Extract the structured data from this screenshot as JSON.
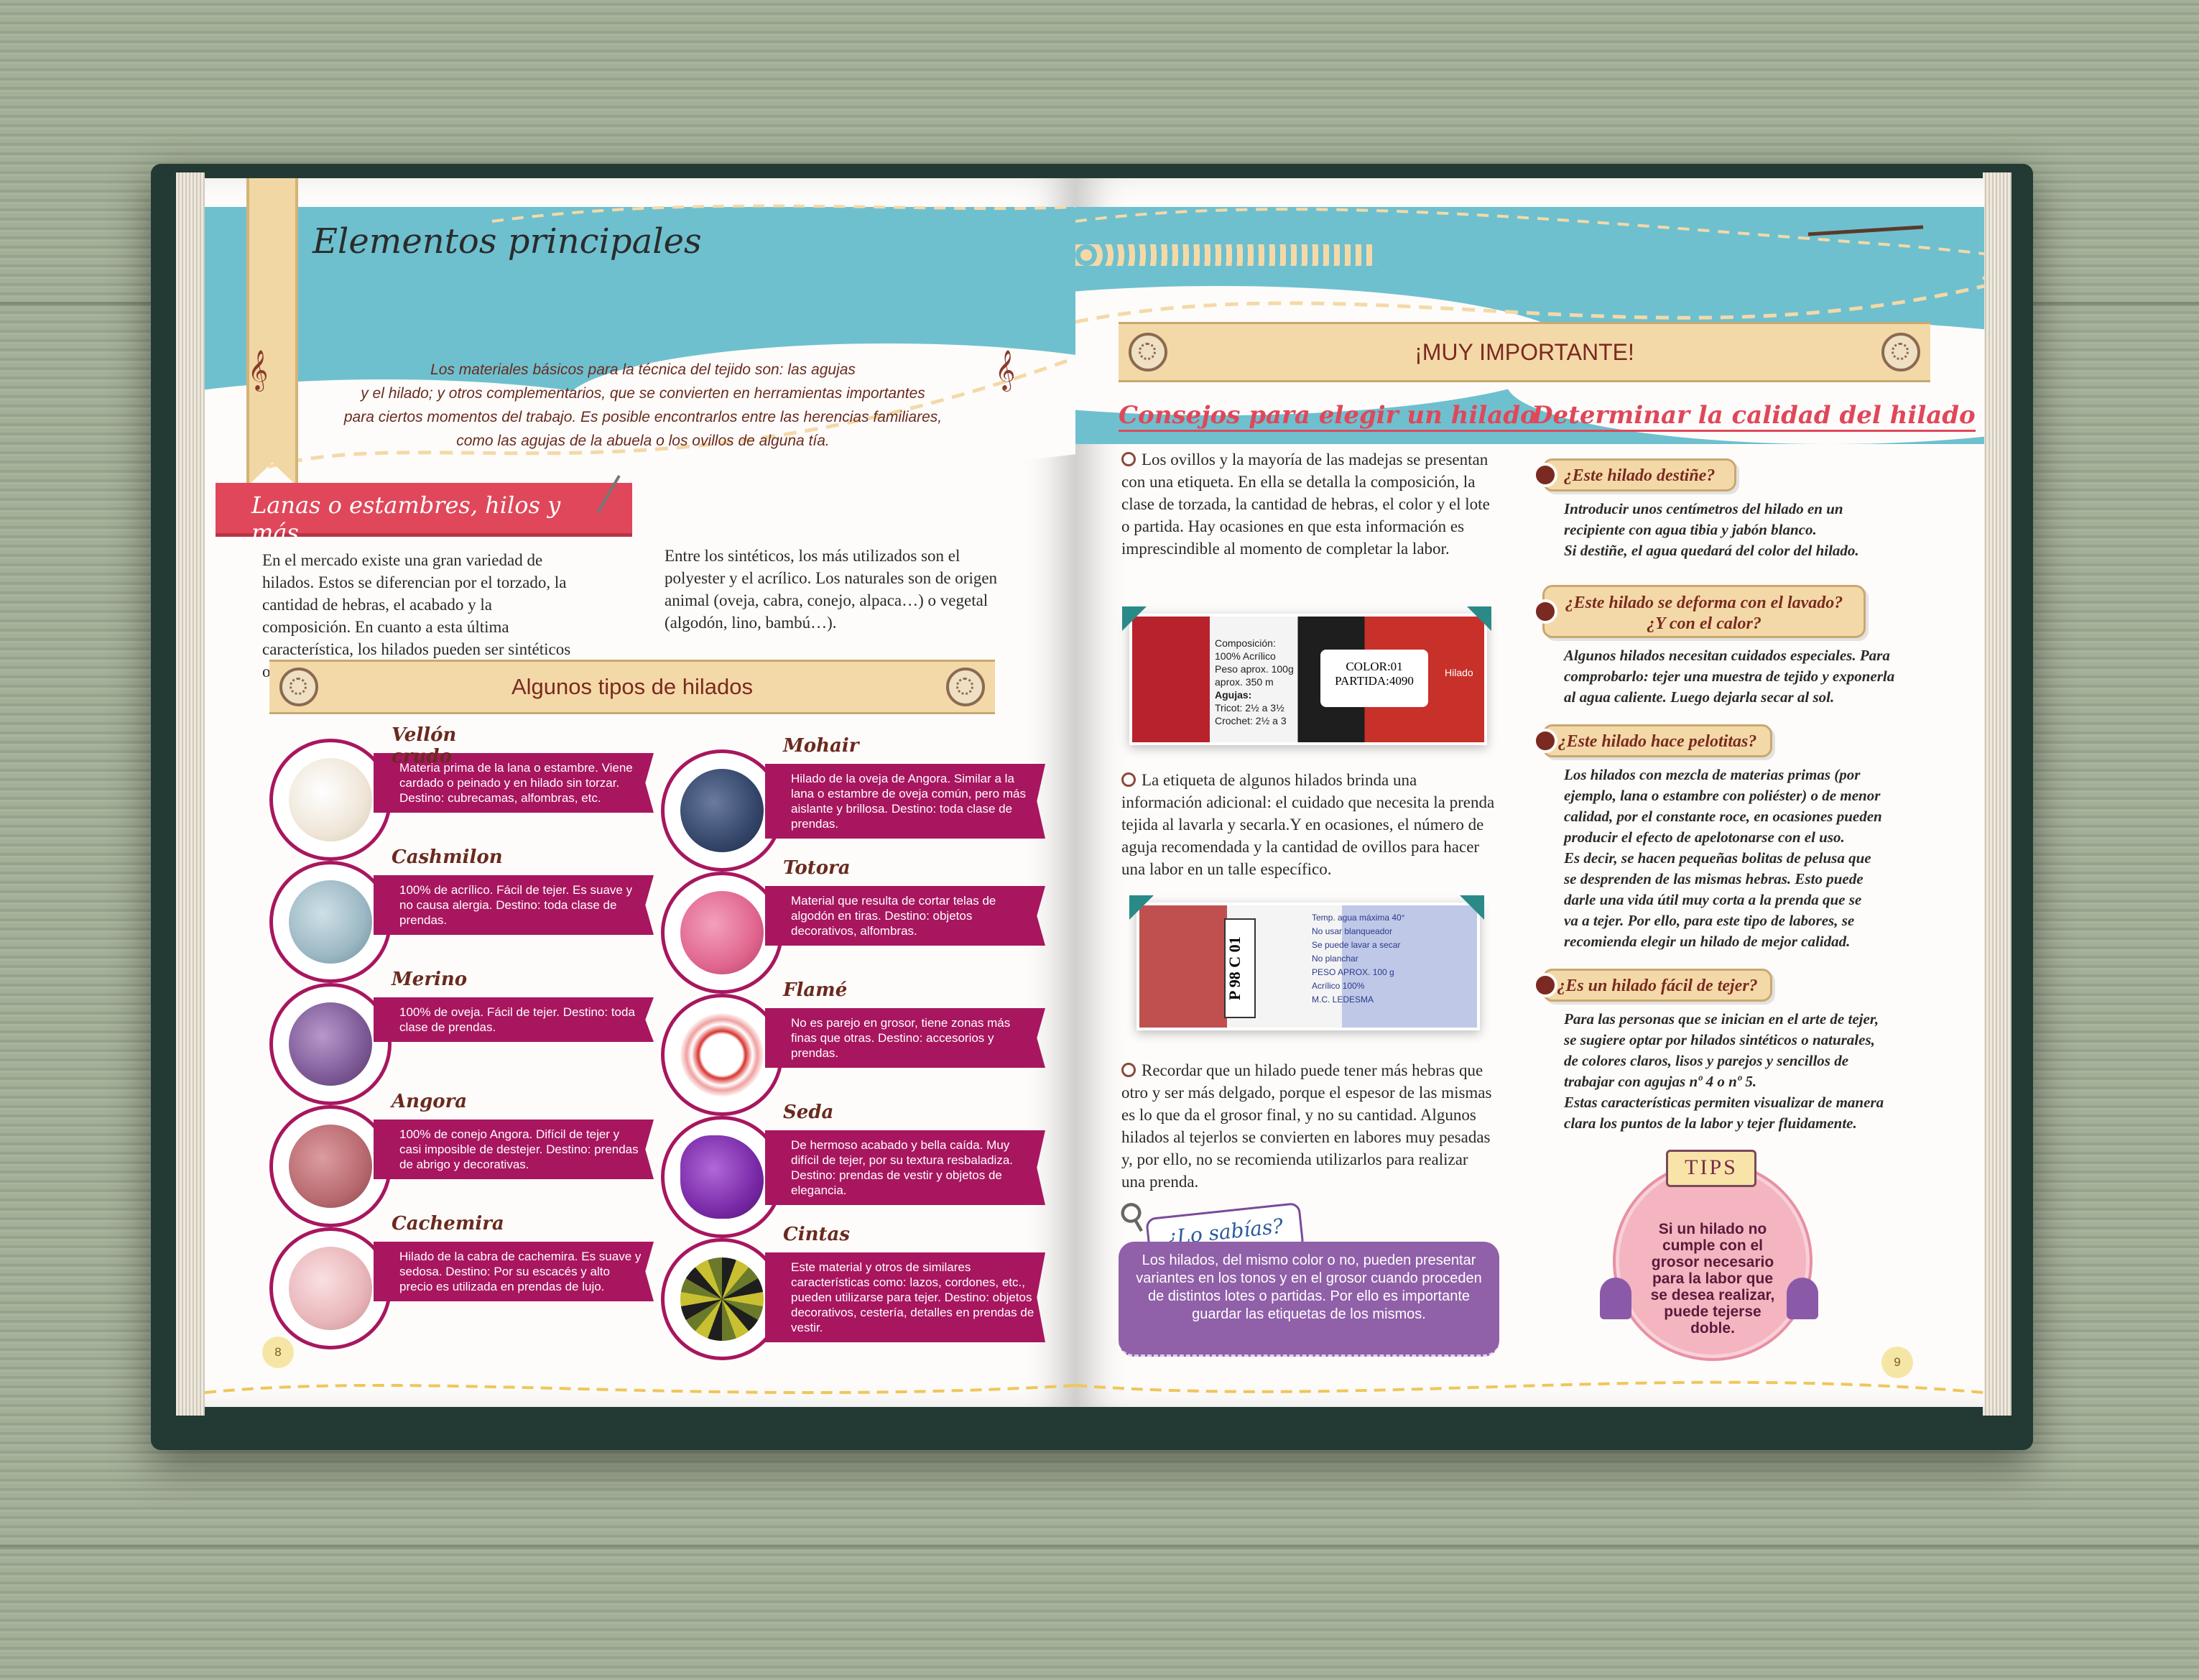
{
  "header": {
    "title": "Elementos principales"
  },
  "intro": {
    "lines": [
      "Los materiales básicos para la técnica del tejido son: las agujas",
      "y el hilado; y otros complementarios, que se convierten en herramientas importantes",
      "para ciertos momentos del trabajo. Es posible encontrarlos entre las herencias familiares,",
      "como las agujas de la abuela o los ovillos de alguna tía."
    ]
  },
  "lanas": {
    "title": "Lanas o estambres, hilos y más...",
    "col1": "En el mercado existe una gran variedad de hilados. Estos se diferencian por el torzado, la cantidad de hebras, el acabado y la composición. En cuanto a esta última característica, los hilados pueden ser sintéticos o naturales.",
    "col2": "Entre los sintéticos, los más utilizados son el polyester y el acrílico. Los naturales son de origen animal (oveja, cabra, conejo, alpaca…) o vegetal (algodón, lino, bambú…)."
  },
  "tipos": {
    "title": "Algunos tipos de hilados",
    "items": [
      {
        "name": "Vellón crudo",
        "desc": "Materia prima de la lana o estambre. Viene cardado o peinado y en hilado sin torzar. Destino: cubrecamas, alfombras, etc.",
        "color": "#efe6d8"
      },
      {
        "name": "Mohair",
        "desc": "Hilado de la oveja de Angora. Similar a la lana o estambre de oveja común, pero más aislante y brillosa. Destino: toda clase de prendas.",
        "color": "#34466a"
      },
      {
        "name": "Cashmilon",
        "desc": "100% de acrílico. Fácil de tejer. Es suave y no causa alergia. Destino: toda clase de prendas.",
        "color": "#9cb8c4"
      },
      {
        "name": "Totora",
        "desc": "Material que resulta de cortar telas de algodón en tiras. Destino: objetos decorativos, alfombras.",
        "color": "#e0668e"
      },
      {
        "name": "Merino",
        "desc": "100% de oveja. Fácil de tejer. Destino: toda clase de prendas.",
        "color": "#7d5a96"
      },
      {
        "name": "Flamé",
        "desc": "No es parejo en grosor, tiene zonas más finas que otras. Destino: accesorios y prendas.",
        "color": "#d8322e"
      },
      {
        "name": "Angora",
        "desc": "100% de conejo Angora. Difícil de tejer y casi imposible de destejer. Destino: prendas de abrigo y decorativas.",
        "color": "#b86a70"
      },
      {
        "name": "Seda",
        "desc": "De hermoso acabado y bella caída. Muy difícil de tejer, por su textura resbaladiza. Destino: prendas de vestir y objetos de elegancia.",
        "color": "#7a2aa8"
      },
      {
        "name": "Cachemira",
        "desc": "Hilado de la cabra de cachemira. Es suave y sedosa. Destino: Por su escacés y alto precio es utilizada en prendas de lujo.",
        "color": "#e8b6ba"
      },
      {
        "name": "Cintas",
        "desc": "Este material y otros de similares características como: lazos, cordones, etc., pueden utilizarse para tejer. Destino: objetos decorativos, cestería, detalles en prendas de vestir.",
        "color": "#9a9a3a"
      }
    ]
  },
  "important": {
    "title": "¡MUY IMPORTANTE!"
  },
  "consejos": {
    "title": "Consejos para elegir un hilado",
    "p1": "Los ovillos y la mayoría de las madejas se presentan con una etiqueta. En ella se detalla la composición, la clase de torzada, la cantidad de hebras, el color y el lote o partida. Hay ocasiones en que esta información es imprescindible al momento de completar la labor.",
    "p2": "La etiqueta de algunos hilados brinda una información adicional: el cuidado que necesita la prenda tejida al lavarla y secarla.Y en ocasiones, el número de aguja recomendada y la cantidad de ovillos para hacer una labor en un talle específico.",
    "p3": "Recordar que un hilado puede tener más hebras que otro y ser más delgado, porque el espesor de las mismas es lo que da el grosor final, y no su cantidad. Algunos hilados al tejerlos se convierten en labores muy pesadas y, por ello, no se recomienda utilizarlos para realizar una prenda."
  },
  "label1": {
    "comp": [
      "Composición:",
      "100% Acrílico",
      "Peso aprox. 100g",
      "aprox. 350 m",
      "Agujas:",
      "Tricot: 2½ a 3½",
      "Crochet: 2½ a 3"
    ],
    "color": "COLOR:01",
    "partida": "PARTIDA:4090",
    "brand": "Hilado"
  },
  "label2": {
    "code": "P 98 C 01",
    "care": [
      "Temp. agua máxima 40°",
      "No usar blanqueador",
      "Se puede lavar a secar",
      "No planchar"
    ],
    "weight": [
      "PESO APROX. 100 g",
      "Acrílico 100%"
    ],
    "maker": "M.C. LEDESMA"
  },
  "sabias": {
    "title": "¿Lo sabías?",
    "text": "Los hilados, del mismo color o no, pueden presentar variantes en los tonos y en el grosor cuando proceden de distintos lotes o partidas. Por ello es importante guardar las etiquetas de los mismos."
  },
  "calidad": {
    "title": "Determinar la calidad del hilado",
    "q1": "¿Este hilado destiñe?",
    "a1": [
      "Introducir unos centímetros del hilado en un",
      "recipiente con agua tibia y jabón blanco.",
      "Si destiñe, el agua quedará del color del hilado."
    ],
    "q2a": "¿Este hilado se deforma con el lavado?",
    "q2b": "¿Y con el calor?",
    "a2": [
      "Algunos hilados necesitan cuidados especiales. Para",
      "comprobarlo: tejer una muestra de tejido y exponerla",
      "al agua caliente. Luego dejarla secar al sol."
    ],
    "q3": "¿Este hilado hace pelotitas?",
    "a3": [
      "Los hilados con mezcla de materias primas (por",
      "ejemplo, lana o estambre con poliéster) o de menor",
      "calidad, por el constante roce, en ocasiones pueden",
      "producir el efecto de apelotonarse con el uso.",
      "Es decir, se hacen pequeñas bolitas de pelusa que",
      "se desprenden de las mismas hebras. Esto puede",
      "darle una vida útil muy corta a la prenda que se",
      "va a tejer. Por ello, para este tipo de labores, se",
      "recomienda elegir un hilado de mejor calidad."
    ],
    "q4": "¿Es un hilado fácil de tejer?",
    "a4": [
      "Para las personas que se inician en el arte de tejer,",
      "se sugiere optar por hilados sintéticos o naturales,",
      "de colores claros, lisos y parejos y sencillos de",
      "trabajar con agujas nº 4 o nº 5.",
      "Estas características permiten visualizar de manera",
      "clara los puntos de la labor y tejer fluidamente."
    ]
  },
  "tips": {
    "label": "TIPS",
    "lines": [
      "Si un hilado no",
      "cumple con el",
      "grosor necesario",
      "para la labor que",
      "se desea realizar,",
      "puede tejerse",
      "doble."
    ]
  },
  "pages": {
    "left": "8",
    "right": "9"
  },
  "colors": {
    "magenta": "#a8165f",
    "sky": "#6ec0cf",
    "sand": "#f4d9a8",
    "red": "#e0475a",
    "purple": "#9060a8"
  }
}
